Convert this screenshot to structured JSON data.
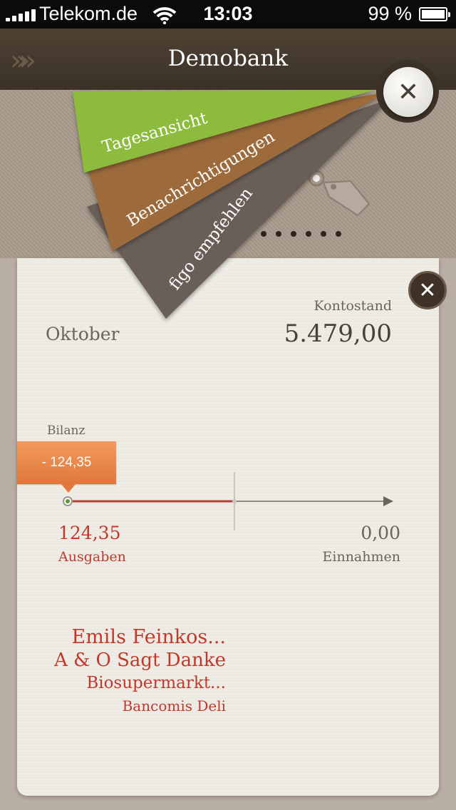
{
  "status_bar": {
    "carrier": "Telekom.de",
    "time": "13:03",
    "battery": "99 %"
  },
  "nav": {
    "title": "Demobank"
  },
  "menu": {
    "items": [
      {
        "label": "Tagesansicht",
        "color": "#8dbb3c"
      },
      {
        "label": "Benachrichtigungen",
        "color": "#9c6a3a"
      },
      {
        "label": "figo empfehlen",
        "color": "#6b5f58"
      }
    ]
  },
  "account": {
    "kontostand_label": "Kontostand",
    "month": "Oktober",
    "balance": "5.479,00"
  },
  "bilanz": {
    "label": "Bilanz",
    "value": "- 124,35",
    "ausgaben_value": "124,35",
    "ausgaben_label": "Ausgaben",
    "einnahmen_value": "0,00",
    "einnahmen_label": "Einnahmen"
  },
  "merchants": [
    "Emils Feinkos...",
    "A & O Sagt Danke",
    "Biosupermarkt...",
    "Bancomis Deli"
  ],
  "colors": {
    "accent_red": "#c0392b",
    "orange": "#e8844a",
    "nav_brown": "#3b3127"
  }
}
